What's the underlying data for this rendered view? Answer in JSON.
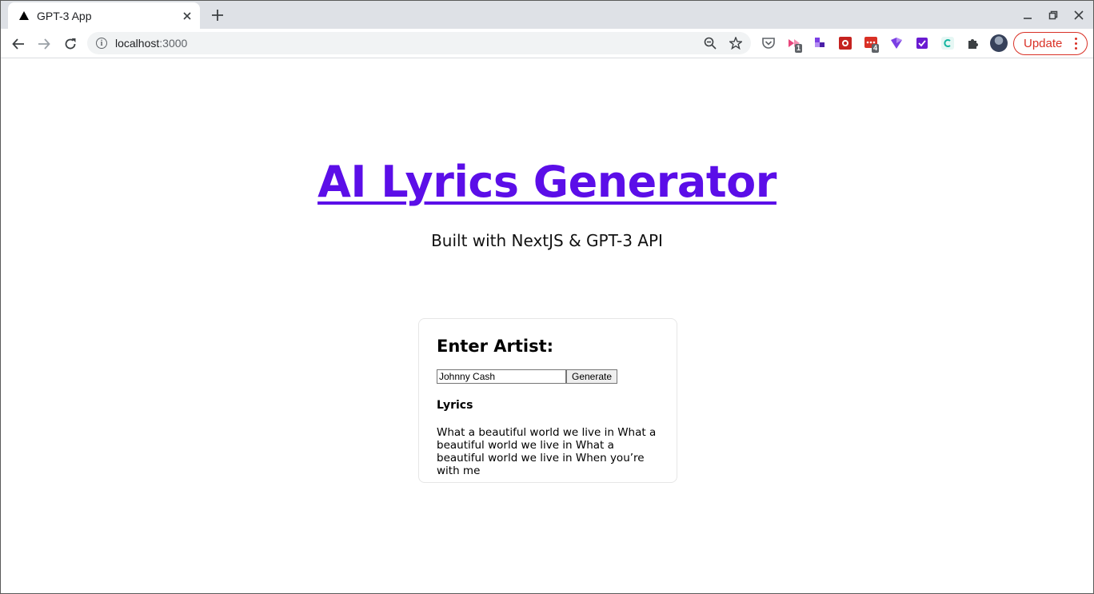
{
  "browser": {
    "tab_title": "GPT-3 App",
    "url_host": "localhost",
    "url_port": ":3000",
    "update_label": "Update",
    "extensions": [
      {
        "name": "pocket-icon",
        "color": "#5f6368"
      },
      {
        "name": "extension-1-icon",
        "color": "#e8467c",
        "badge": "1"
      },
      {
        "name": "extension-2-icon",
        "color": "#7b3fe4"
      },
      {
        "name": "extension-3-icon",
        "color": "#c5221f"
      },
      {
        "name": "extension-4-icon",
        "color": "#d93025",
        "badge": "4"
      },
      {
        "name": "extension-5-icon",
        "color": "#7b3fe4"
      },
      {
        "name": "extension-6-icon",
        "color": "#6a1bd1"
      },
      {
        "name": "extension-7-icon",
        "color": "#12b5a0"
      }
    ]
  },
  "page": {
    "title": "AI Lyrics Generator",
    "subtitle": "Built with NextJS & GPT-3 API",
    "card": {
      "heading": "Enter Artist:",
      "artist_value": "Johnny Cash",
      "generate_label": "Generate",
      "lyrics_heading": "Lyrics",
      "lyrics_text": "What a beautiful world we live in What a beautiful world we live in What a beautiful world we live in When you’re with me"
    }
  },
  "colors": {
    "title_link": "#5b0ee8",
    "update_accent": "#d93025",
    "tabstrip": "#dee1e6"
  }
}
